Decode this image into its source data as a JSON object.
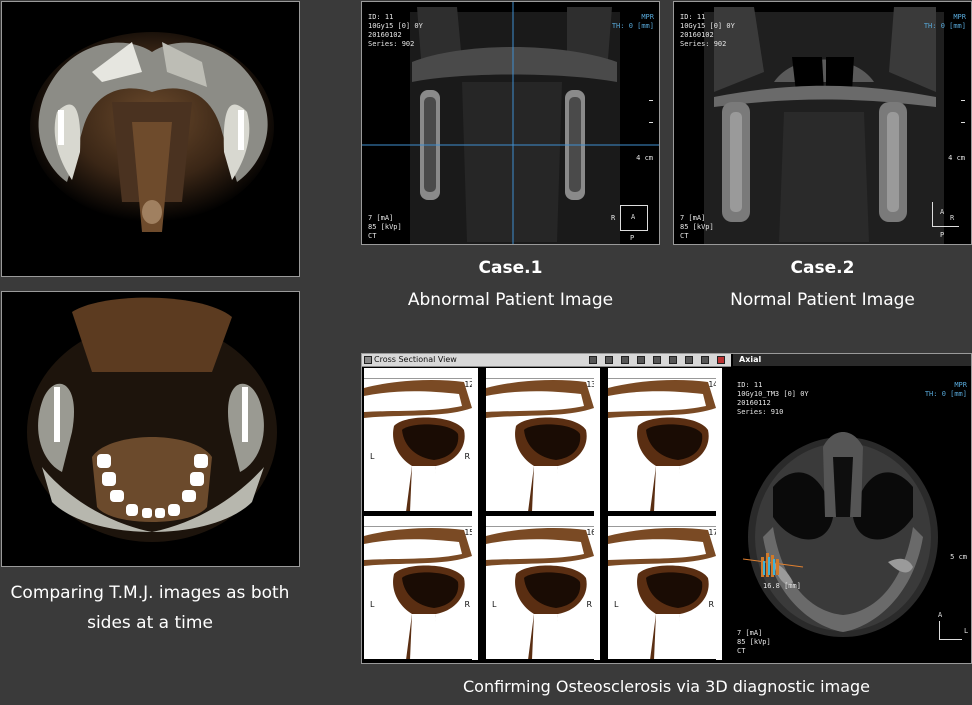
{
  "left_captions": {
    "line1": "Comparing T.M.J. images as both",
    "line2": "sides at a time"
  },
  "case1": {
    "title": "Case.1",
    "subtitle": "Abnormal Patient Image",
    "overlay": {
      "id": "ID: 11",
      "line2": "10Gy15 [0] 0Y",
      "date": "20160102",
      "series": "Series: 902",
      "mode": "MPR",
      "th": "TH: 0 [mm]",
      "scale": "4 cm",
      "ma": "7 [mA]",
      "kvp": "85 [kVp]",
      "ct": "CT",
      "r": "R",
      "a": "A",
      "p": "P"
    }
  },
  "case2": {
    "title": "Case.2",
    "subtitle": "Normal Patient Image",
    "overlay": {
      "id": "ID: 11",
      "line2": "10Gy15 [0] 0Y",
      "date": "20160102",
      "series": "Series: 902",
      "mode": "MPR",
      "th": "TH: 0 [mm]",
      "scale": "4 cm",
      "ma": "7 [mA]",
      "kvp": "85 [kVp]",
      "ct": "CT",
      "r": "R",
      "a": "A",
      "p": "P"
    }
  },
  "viewer": {
    "title": "Cross Sectional View",
    "axial_title": "Axial",
    "cells": [
      {
        "num": "12",
        "l": "L",
        "r": "R"
      },
      {
        "num": "13",
        "l": "",
        "r": ""
      },
      {
        "num": "14",
        "l": "",
        "r": ""
      },
      {
        "num": "15",
        "l": "L",
        "r": "R"
      },
      {
        "num": "16",
        "l": "L",
        "r": "R"
      },
      {
        "num": "17",
        "l": "L",
        "r": "R"
      }
    ],
    "axial_overlay": {
      "id": "ID: 11",
      "line2": "10Gy10_TM3 [0] 0Y",
      "date": "20160112",
      "series": "Series: 910",
      "mode": "MPR",
      "th": "TH: 0 [mm]",
      "measure": "16.8 [mm]",
      "scale": "5 cm",
      "ma": "7 [mA]",
      "kvp": "85 [kVp]",
      "ct": "CT",
      "a": "A",
      "l": "L"
    }
  },
  "bottom_caption": "Confirming Osteosclerosis via 3D diagnostic image",
  "colors": {
    "background": "#3a3a3a",
    "crosshair": "#3f8fd0",
    "overlay_blue": "#56a6d6",
    "bone_brown": "#7a4a24"
  }
}
